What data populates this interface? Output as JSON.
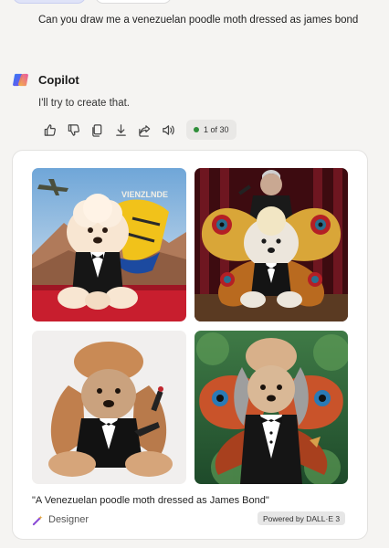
{
  "conversation": {
    "user_message": "Can you draw me a  venezuelan poodle moth dressed as james bond",
    "assistant": {
      "name": "Copilot",
      "reply": "I'll try to create that.",
      "action_icons": [
        "thumbs-up-icon",
        "thumbs-down-icon",
        "copy-icon",
        "download-icon",
        "share-icon",
        "read-aloud-icon"
      ],
      "counter": "1 of 30"
    }
  },
  "image_card": {
    "images": [
      {
        "name": "generated-image-1",
        "sign_text": "VIENZLNDE"
      },
      {
        "name": "generated-image-2"
      },
      {
        "name": "generated-image-3"
      },
      {
        "name": "generated-image-4"
      }
    ],
    "caption": "\"A Venezuelan poodle moth dressed as James Bond\"",
    "designer_label": "Designer",
    "powered_by": "Powered by DALL·E 3"
  },
  "colors": {
    "page_bg": "#f5f4f2",
    "counter_dot": "#2f8f3a",
    "designer_accent": "#8a4bd6"
  }
}
